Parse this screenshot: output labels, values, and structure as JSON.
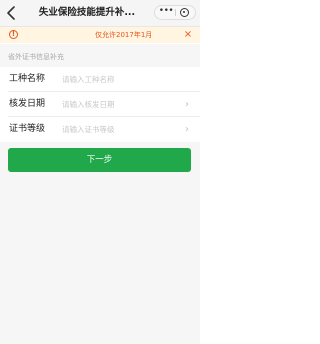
{
  "navbar": {
    "back_icon": "chevron-left-icon",
    "title": "失业保险技能提升补...",
    "more_icon": "more-dots-icon",
    "more_glyph": "•••",
    "close_icon": "mini-program-close-icon"
  },
  "notice": {
    "alert_icon": "alert-circle-icon",
    "alert_glyph": "!",
    "text": "仅允许2017年1月",
    "close_icon": "close-icon",
    "close_glyph": "×",
    "color": "#e8541e",
    "background": "#fff5e0"
  },
  "section": {
    "label": "省外证书信息补充"
  },
  "form": {
    "rows": [
      {
        "label": "工种名称",
        "placeholder": "请输入工种名称",
        "value": "",
        "chevron": false
      },
      {
        "label": "核发日期",
        "placeholder": "请输入核发日期",
        "value": "",
        "chevron": true
      },
      {
        "label": "证书等级",
        "placeholder": "请输入证书等级",
        "value": "",
        "chevron": true
      }
    ],
    "chevron_icon": "chevron-right-icon",
    "chevron_glyph": "›"
  },
  "actions": {
    "next_label": "下一步",
    "accent": "#20a84a"
  }
}
